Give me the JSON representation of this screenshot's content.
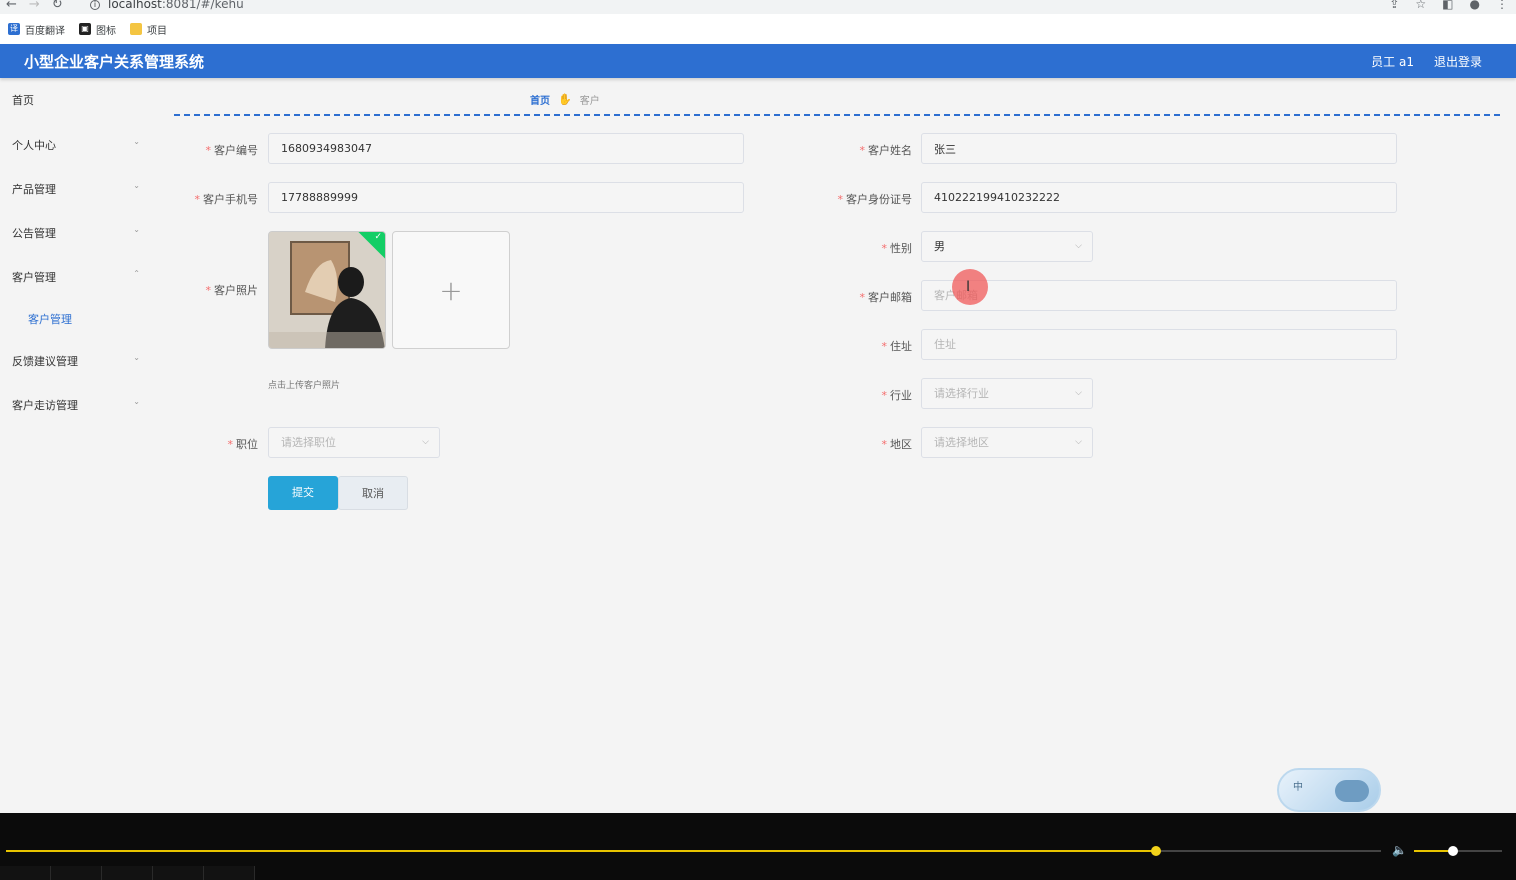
{
  "browser": {
    "url_host": "localhost",
    "url_rest": ":8081/#/kehu",
    "bookmarks": [
      {
        "label": "百度翻译",
        "icon": "translate-icon",
        "color": "#2d6fd1"
      },
      {
        "label": "图标",
        "icon": "image-icon",
        "color": "#222222"
      },
      {
        "label": "项目",
        "icon": "folder-icon",
        "color": "#f4c542"
      }
    ]
  },
  "header": {
    "title": "小型企业客户关系管理系统",
    "user": "员工 a1",
    "logout": "退出登录",
    "color": "#2d6fd1"
  },
  "sidebar": {
    "items": [
      {
        "label": "首页",
        "chevron": ""
      },
      {
        "label": "个人中心",
        "chevron": "⌄"
      },
      {
        "label": "产品管理",
        "chevron": "⌄"
      },
      {
        "label": "公告管理",
        "chevron": "⌄"
      },
      {
        "label": "客户管理",
        "chevron": "⌃"
      },
      {
        "label": "反馈建议管理",
        "chevron": "⌄"
      },
      {
        "label": "客户走访管理",
        "chevron": "⌄"
      }
    ],
    "sub_item": "客户管理"
  },
  "breadcrumb": {
    "home": "首页",
    "current": "客户"
  },
  "form": {
    "customer_no": {
      "label": "客户编号",
      "value": "1680934983047"
    },
    "customer_name": {
      "label": "客户姓名",
      "value": "张三"
    },
    "phone": {
      "label": "客户手机号",
      "value": "17788889999"
    },
    "id_card": {
      "label": "客户身份证号",
      "value": "410222199410232222"
    },
    "photo": {
      "label": "客户照片",
      "tip": "点击上传客户照片"
    },
    "gender": {
      "label": "性别",
      "value": "男"
    },
    "email": {
      "label": "客户邮箱",
      "placeholder": "客户邮箱"
    },
    "address": {
      "label": "住址",
      "placeholder": "住址"
    },
    "industry": {
      "label": "行业",
      "placeholder": "请选择行业"
    },
    "position": {
      "label": "职位",
      "placeholder": "请选择职位"
    },
    "region": {
      "label": "地区",
      "placeholder": "请选择地区"
    },
    "submit": "提交",
    "cancel": "取消"
  },
  "widget": {
    "text": "中"
  },
  "player": {
    "progress": 0.836,
    "volume": 0.44
  }
}
